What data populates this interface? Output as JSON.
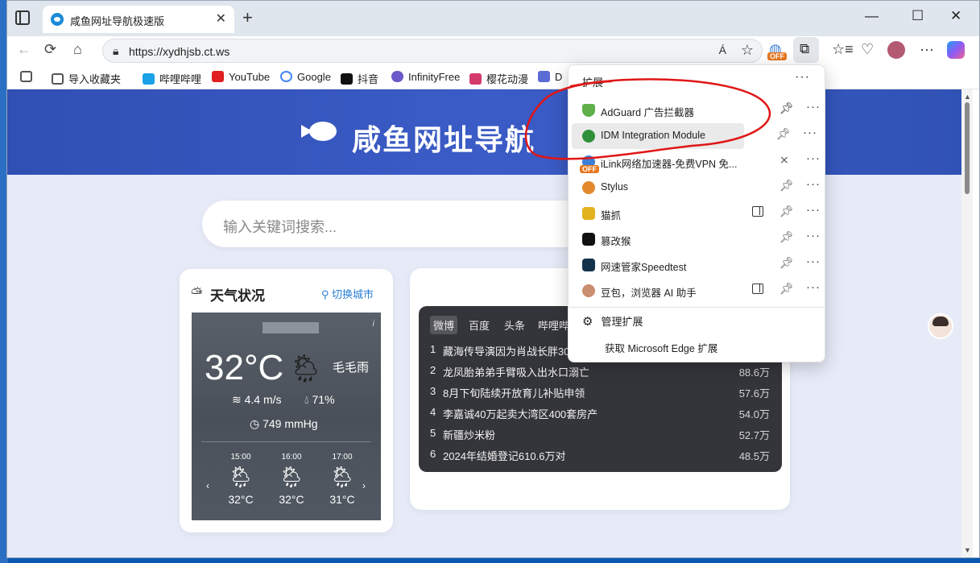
{
  "tab": {
    "title": "咸鱼网址导航极速版",
    "close": "✕",
    "new": "+"
  },
  "window": {
    "minimize": "—",
    "maximize": "☐",
    "close": "✕"
  },
  "nav": {
    "back": "←",
    "refresh": "⟳",
    "home": "⌂",
    "url": "https://xydhjsb.ct.ws",
    "read_aloud": "Á",
    "favorite": "☆",
    "off_badge": "OFF",
    "favorites": "☆≡",
    "more": "···"
  },
  "bookmarks": [
    {
      "label": "",
      "color": "#555555"
    },
    {
      "label": "导入收藏夹",
      "color": "#555555"
    },
    {
      "label": "哔哩哔哩",
      "color": "#1aa1e6"
    },
    {
      "label": "YouTube",
      "color": "#e02020"
    },
    {
      "label": "Google",
      "color": "#4285f4"
    },
    {
      "label": "抖音",
      "color": "#111111"
    },
    {
      "label": "InfinityFree",
      "color": "#6b58c9"
    },
    {
      "label": "樱花动漫",
      "color": "#d43a6a"
    },
    {
      "label": "D",
      "color": "#5b6bd6"
    }
  ],
  "hero": {
    "title": "咸鱼网址导航"
  },
  "search": {
    "placeholder": "输入关键词搜索..."
  },
  "weather": {
    "header": "天气状况",
    "switch_city": "切换城市",
    "temp": "32°C",
    "condition": "毛毛雨",
    "wind": "4.4 m/s",
    "humidity": "71%",
    "pressure": "749 mmHg",
    "info": "i",
    "prev": "‹",
    "next": "›",
    "forecast": [
      {
        "time": "15:00",
        "temp": "32°C"
      },
      {
        "time": "16:00",
        "temp": "32°C"
      },
      {
        "time": "17:00",
        "temp": "31°C"
      }
    ]
  },
  "hot": {
    "tabs": [
      "微博",
      "百度",
      "头条",
      "哔哩哔"
    ],
    "rows": [
      {
        "rank": "1",
        "text": "藏海传导演因为肖战长胖30",
        "heat": ""
      },
      {
        "rank": "2",
        "text": "龙凤胎弟弟手臂吸入出水口溺亡",
        "heat": "88.6万"
      },
      {
        "rank": "3",
        "text": "8月下旬陆续开放育儿补贴申领",
        "heat": "57.6万"
      },
      {
        "rank": "4",
        "text": "李嘉诚40万起卖大湾区400套房产",
        "heat": "54.0万"
      },
      {
        "rank": "5",
        "text": "新疆炒米粉",
        "heat": "52.7万"
      },
      {
        "rank": "6",
        "text": "2024年结婚登记610.6万对",
        "heat": "48.5万"
      }
    ]
  },
  "extensions": {
    "title": "扩展",
    "more": "···",
    "items": [
      {
        "name": "AdGuard 广告拦截器",
        "color": "#5fb04a",
        "pinned": true,
        "sidepanel": false
      },
      {
        "name": "IDM Integration Module",
        "color": "#2f8f3a",
        "pinned": false,
        "sidepanel": false
      },
      {
        "name": "iLink网络加速器-免费VPN 免...",
        "color": "#3c7fd6",
        "pinned": false,
        "sidepanel": false,
        "badge": "OFF"
      },
      {
        "name": "Stylus",
        "color": "#e3892d",
        "pinned": false,
        "sidepanel": false
      },
      {
        "name": "猫抓",
        "color": "#e3b21f",
        "pinned": false,
        "sidepanel": true
      },
      {
        "name": "篡改猴",
        "color": "#111111",
        "pinned": false,
        "sidepanel": false
      },
      {
        "name": "网速管家Speedtest",
        "color": "#14324a",
        "pinned": false,
        "sidepanel": false
      },
      {
        "name": "豆包，浏览器 AI 助手",
        "color": "#c98e6f",
        "pinned": false,
        "sidepanel": true
      }
    ],
    "manage": "管理扩展",
    "get": "获取 Microsoft Edge 扩展"
  }
}
